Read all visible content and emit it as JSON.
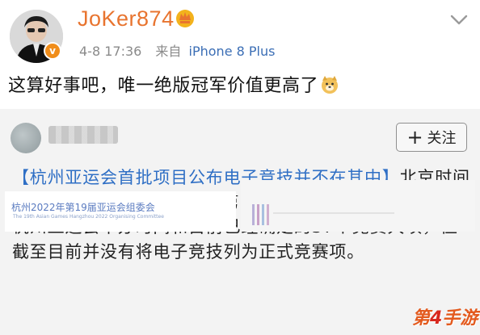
{
  "post": {
    "username": "JoKer874",
    "time": "4-8 17:36",
    "source_prefix": "来自",
    "source_device": "iPhone 8 Plus",
    "text": "这算好事吧，唯一绝版冠军价值更高了"
  },
  "repost": {
    "follow_label": "关注",
    "headline": "【杭州亚运会首批项目公布电子竞技并不在其中】",
    "body": "北京时间4月8日下午，杭州2022年第19届亚运会组委会官网公布了杭州亚运会举办时间和目前已经确定的37个竞赛大项，但截至目前并没有将电子竞技列为正式竞赛项。",
    "embed_org": "杭州2022年第19届亚运会组委会",
    "embed_org_en": "The 19th Asian Games Hangzhou 2022 Organising Committee"
  },
  "watermark": {
    "prefix": "第",
    "digit": "4",
    "suffix": "手游"
  },
  "colors": {
    "username": "#e8742f",
    "link": "#2f6fc5",
    "verified": "#f08d1a",
    "card_bg": "#f3f3f3"
  },
  "icons": [
    "verified-badge-icon",
    "vip-crown-icon",
    "chevron-down-icon",
    "doge-emoji-icon",
    "plus-icon"
  ]
}
